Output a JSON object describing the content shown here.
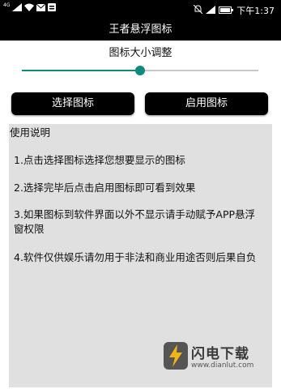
{
  "status_bar": {
    "network": "4G",
    "time": "下午1:37",
    "icons": [
      "wifi-icon",
      "mail-icon",
      "notification-icon",
      "mute-icon",
      "battery-icon"
    ]
  },
  "app": {
    "title": "王者悬浮图标"
  },
  "size_slider": {
    "label": "图标大小调整",
    "value_fraction": 0.5
  },
  "buttons": {
    "select": "选择图标",
    "enable": "启用图标"
  },
  "instructions": {
    "heading": "使用说明",
    "items": [
      "1.点击选择图标选择您想要显示的图标",
      "2.选择完毕后点击启用图标即可看到效果",
      "3.如果图标到软件界面以外不显示请手动赋予APP悬浮窗权限",
      "4.软件仅供娱乐请勿用于非法和商业用途否则后果自负"
    ]
  },
  "watermark": {
    "name": "闪电下载",
    "url": "www.dianlut.com"
  },
  "colors": {
    "accent": "#0f8a7f",
    "panel": "#e0e0e0",
    "bar": "#000000"
  }
}
